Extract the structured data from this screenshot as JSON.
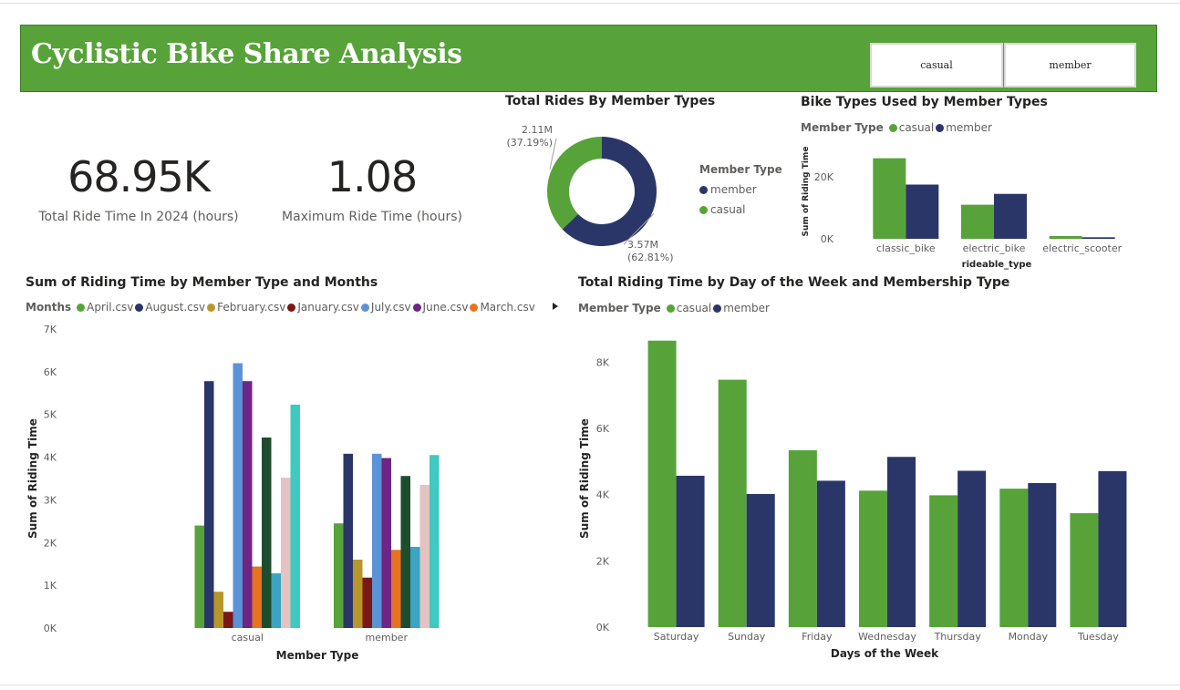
{
  "header": {
    "title": "Cyclistic Bike Share Analysis"
  },
  "slicer": {
    "options": [
      "casual",
      "member"
    ]
  },
  "kpis": [
    {
      "value": "68.95K",
      "label": "Total Ride Time In 2024 (hours)"
    },
    {
      "value": "1.08",
      "label": "Maximum Ride Time (hours)"
    }
  ],
  "colors": {
    "casual": "#57a33a",
    "member": "#2b3668",
    "header": "#57a33a"
  },
  "chart_data": [
    {
      "id": "donut",
      "type": "pie",
      "title": "Total Rides By Member Types",
      "legend_title": "Member Type",
      "legend_placement": "right",
      "slices": [
        {
          "name": "member",
          "value": 3570000,
          "label": "3.57M",
          "pct_label": "(62.81%)",
          "color": "#2b3668"
        },
        {
          "name": "casual",
          "value": 2110000,
          "label": "2.11M",
          "pct_label": "(37.19%)",
          "color": "#57a33a"
        }
      ]
    },
    {
      "id": "bike",
      "type": "bar",
      "title": "Bike Types Used by Member Types",
      "legend_title": "Member Type",
      "legend_placement": "top-left",
      "xlabel": "rideable_type",
      "ylabel": "Sum of Riding Time",
      "categories": [
        "classic_bike",
        "electric_bike",
        "electric_scooter"
      ],
      "ylim": [
        0,
        30000
      ],
      "yticks": [
        0,
        20000
      ],
      "ytick_labels": [
        "0K",
        "20K"
      ],
      "grid": false,
      "series": [
        {
          "name": "casual",
          "color": "#57a33a",
          "values": [
            26000,
            11000,
            900
          ]
        },
        {
          "name": "member",
          "color": "#2b3668",
          "values": [
            17500,
            14500,
            500
          ]
        }
      ]
    },
    {
      "id": "months",
      "type": "bar",
      "title": "Sum of Riding Time by Member Type and Months",
      "legend_title": "Months",
      "legend_placement": "top-left",
      "xlabel": "Member Type",
      "ylabel": "Sum of Riding Time",
      "categories": [
        "casual",
        "member"
      ],
      "ylim": [
        0,
        7000
      ],
      "yticks": [
        0,
        1000,
        2000,
        3000,
        4000,
        5000,
        6000,
        7000
      ],
      "ytick_labels": [
        "0K",
        "1K",
        "2K",
        "3K",
        "4K",
        "5K",
        "6K",
        "7K"
      ],
      "grid": false,
      "series": [
        {
          "name": "April.csv",
          "color": "#57a33a",
          "values": [
            2400,
            2450
          ],
          "legend": true
        },
        {
          "name": "August.csv",
          "color": "#2b3668",
          "values": [
            5780,
            4080
          ],
          "legend": true
        },
        {
          "name": "February.csv",
          "color": "#b8962a",
          "values": [
            850,
            1600
          ],
          "legend": true
        },
        {
          "name": "January.csv",
          "color": "#7b1717",
          "values": [
            380,
            1180
          ],
          "legend": true
        },
        {
          "name": "July.csv",
          "color": "#5b93d6",
          "values": [
            6200,
            4080
          ],
          "legend": true
        },
        {
          "name": "June.csv",
          "color": "#6e2585",
          "values": [
            5780,
            3980
          ],
          "legend": true
        },
        {
          "name": "March.csv",
          "color": "#e8731f",
          "values": [
            1440,
            1830
          ],
          "legend": true
        },
        {
          "name": "",
          "color": "#1d4d2c",
          "values": [
            4460,
            3560
          ],
          "legend": false
        },
        {
          "name": "",
          "color": "#3ba4c3",
          "values": [
            1280,
            1900
          ],
          "legend": false
        },
        {
          "name": "",
          "color": "#e4c3c3",
          "values": [
            3520,
            3350
          ],
          "legend": false
        },
        {
          "name": "",
          "color": "#3fc9c0",
          "values": [
            5230,
            4050
          ],
          "legend": false
        }
      ]
    },
    {
      "id": "week",
      "type": "bar",
      "title": "Total Riding Time by Day of the Week and Membership Type",
      "legend_title": "Member Type",
      "legend_placement": "top-left",
      "xlabel": "Days of the Week",
      "ylabel": "Sum of Riding Time",
      "categories": [
        "Saturday",
        "Sunday",
        "Friday",
        "Wednesday",
        "Thursday",
        "Monday",
        "Tuesday"
      ],
      "ylim": [
        0,
        9000
      ],
      "yticks": [
        0,
        2000,
        4000,
        6000,
        8000
      ],
      "ytick_labels": [
        "0K",
        "2K",
        "4K",
        "6K",
        "8K"
      ],
      "grid": false,
      "series": [
        {
          "name": "casual",
          "color": "#57a33a",
          "values": [
            8650,
            7470,
            5340,
            4120,
            3980,
            4180,
            3440
          ]
        },
        {
          "name": "member",
          "color": "#2b3668",
          "values": [
            4570,
            4020,
            4420,
            5140,
            4720,
            4350,
            4710
          ]
        }
      ]
    }
  ]
}
